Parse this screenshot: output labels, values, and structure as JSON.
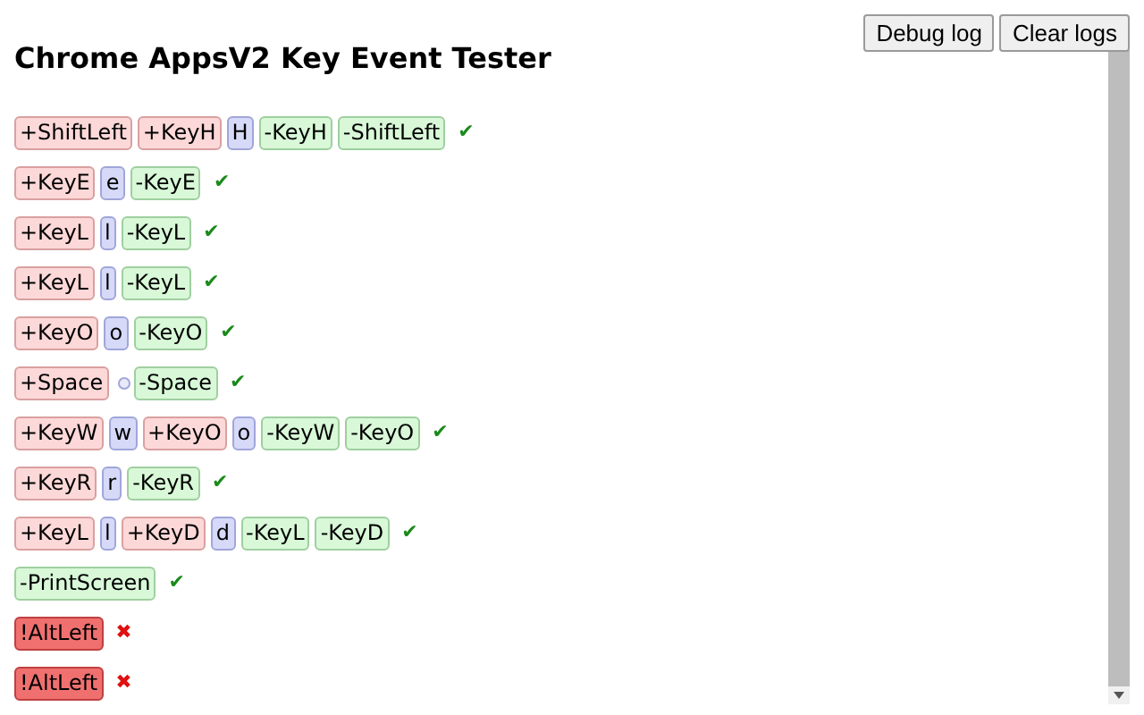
{
  "title": "Chrome AppsV2 Key Event Tester",
  "buttons": [
    "Debug log",
    "Clear logs"
  ],
  "rows": [
    {
      "tokens": [
        {
          "kind": "down",
          "text": "+ShiftLeft"
        },
        {
          "kind": "down",
          "text": "+KeyH"
        },
        {
          "kind": "press",
          "text": "H"
        },
        {
          "kind": "up",
          "text": "-KeyH"
        },
        {
          "kind": "up",
          "text": "-ShiftLeft"
        }
      ],
      "kind": "ok",
      "mark": "✔"
    },
    {
      "tokens": [
        {
          "kind": "down",
          "text": "+KeyE"
        },
        {
          "kind": "press",
          "text": "e"
        },
        {
          "kind": "up",
          "text": "-KeyE"
        }
      ],
      "kind": "ok",
      "mark": "✔"
    },
    {
      "tokens": [
        {
          "kind": "down",
          "text": "+KeyL"
        },
        {
          "kind": "press",
          "text": "l"
        },
        {
          "kind": "up",
          "text": "-KeyL"
        }
      ],
      "kind": "ok",
      "mark": "✔"
    },
    {
      "tokens": [
        {
          "kind": "down",
          "text": "+KeyL"
        },
        {
          "kind": "press",
          "text": "l"
        },
        {
          "kind": "up",
          "text": "-KeyL"
        }
      ],
      "kind": "ok",
      "mark": "✔"
    },
    {
      "tokens": [
        {
          "kind": "down",
          "text": "+KeyO"
        },
        {
          "kind": "press",
          "text": "o"
        },
        {
          "kind": "up",
          "text": "-KeyO"
        }
      ],
      "kind": "ok",
      "mark": "✔"
    },
    {
      "tokens": [
        {
          "kind": "down",
          "text": "+Space"
        },
        {
          "kind": "space"
        },
        {
          "kind": "up",
          "text": "-Space"
        }
      ],
      "kind": "ok",
      "mark": "✔"
    },
    {
      "tokens": [
        {
          "kind": "down",
          "text": "+KeyW"
        },
        {
          "kind": "press",
          "text": "w"
        },
        {
          "kind": "down",
          "text": "+KeyO"
        },
        {
          "kind": "press",
          "text": "o"
        },
        {
          "kind": "up",
          "text": "-KeyW"
        },
        {
          "kind": "up",
          "text": "-KeyO"
        }
      ],
      "kind": "ok",
      "mark": "✔"
    },
    {
      "tokens": [
        {
          "kind": "down",
          "text": "+KeyR"
        },
        {
          "kind": "press",
          "text": "r"
        },
        {
          "kind": "up",
          "text": "-KeyR"
        }
      ],
      "kind": "ok",
      "mark": "✔"
    },
    {
      "tokens": [
        {
          "kind": "down",
          "text": "+KeyL"
        },
        {
          "kind": "press",
          "text": "l"
        },
        {
          "kind": "down",
          "text": "+KeyD"
        },
        {
          "kind": "press",
          "text": "d"
        },
        {
          "kind": "up",
          "text": "-KeyL"
        },
        {
          "kind": "up",
          "text": "-KeyD"
        }
      ],
      "kind": "ok",
      "mark": "✔"
    },
    {
      "tokens": [
        {
          "kind": "up",
          "text": "-PrintScreen"
        }
      ],
      "kind": "ok",
      "mark": "✔"
    },
    {
      "tokens": [
        {
          "kind": "error",
          "text": "!AltLeft"
        }
      ],
      "kind": "fail",
      "mark": "✖"
    },
    {
      "tokens": [
        {
          "kind": "error",
          "text": "!AltLeft"
        }
      ],
      "kind": "fail",
      "mark": "✖"
    }
  ]
}
